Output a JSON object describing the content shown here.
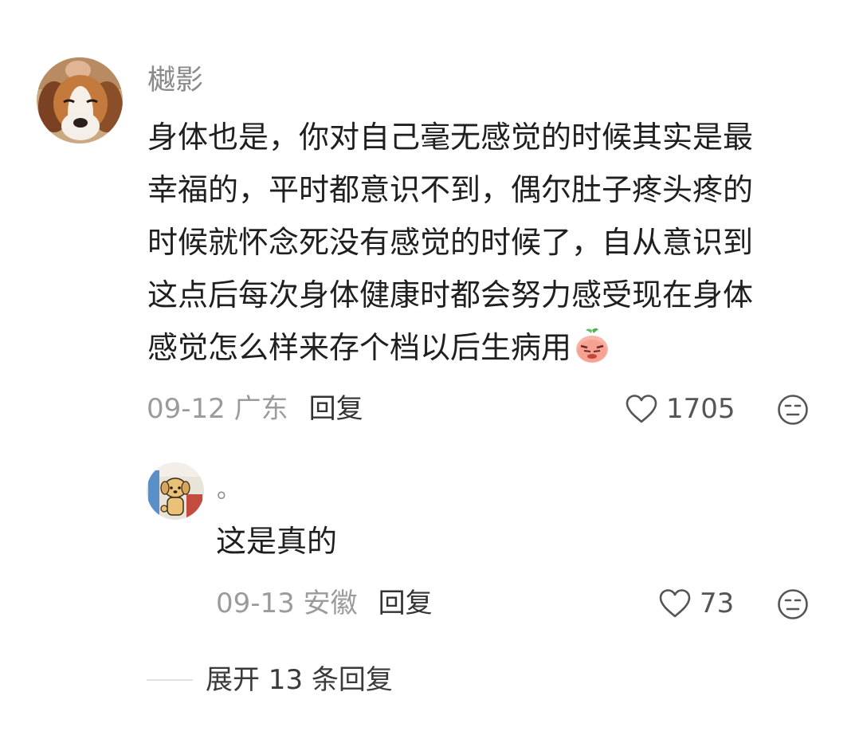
{
  "comment": {
    "username": "樾影",
    "content_lines": [
      "身体也是，你对自己毫无感觉的时候其实是最",
      "幸福的，平时都意识不到，偶尔肚子疼头疼的",
      "时候就怀念死没有感觉的时候了，自从意识到",
      "这点后每次身体健康时都会努力感受现在身体",
      "感觉怎么样来存个档以后生病用"
    ],
    "emoji_icon": "crying-radish-emoji",
    "date_location": "09-12 广东",
    "reply_label": "回复",
    "like_count": "1705",
    "like_icon": "heart-outline-icon",
    "dislike_icon": "unamused-face-icon"
  },
  "reply": {
    "username": "。",
    "content": "这是真的",
    "date_location": "09-13 安徽",
    "reply_label": "回复",
    "like_count": "73",
    "like_icon": "heart-outline-icon",
    "dislike_icon": "unamused-face-icon"
  },
  "expand": {
    "label": "展开 13 条回复"
  },
  "colors": {
    "meta_gray": "#9b9b9b",
    "text_dark": "#1f1f1f",
    "icon_gray": "#555555"
  }
}
